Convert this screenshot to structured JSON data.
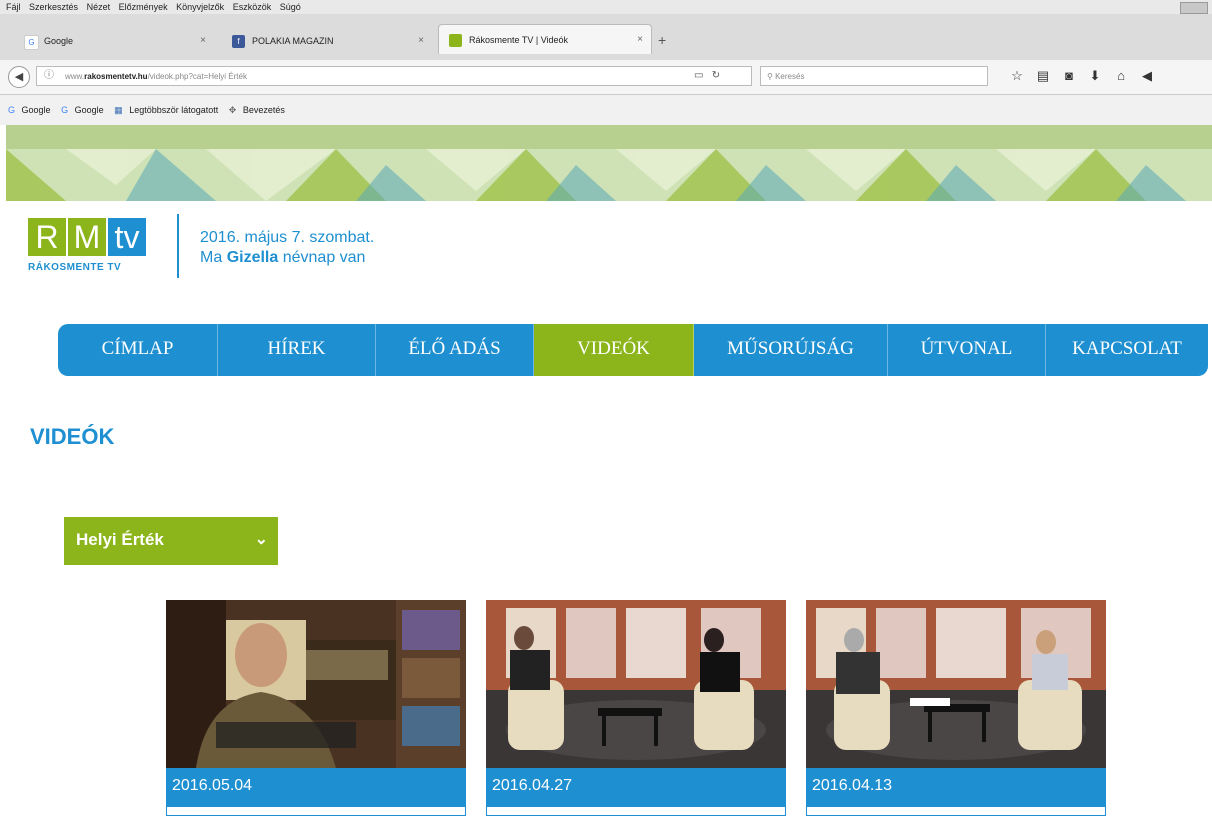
{
  "browser": {
    "menu": [
      "Fájl",
      "Szerkesztés",
      "Nézet",
      "Előzmények",
      "Könyvjelzők",
      "Eszközök",
      "Súgó"
    ],
    "tabs": [
      {
        "title": "Google",
        "icon": "google-icon"
      },
      {
        "title": "POLAKIA MAGAZIN",
        "icon": "facebook-icon"
      },
      {
        "title": "Rákosmente TV | Videók",
        "icon": "rmtv-icon"
      }
    ],
    "url_prefix": "www.",
    "url_domain": "rakosmentetv.hu",
    "url_path": "/videok.php?cat=Helyi Érték",
    "search_placeholder": "Keresés",
    "bookmarks": [
      "Google",
      "Google",
      "Legtöbbször látogatott",
      "Bevezetés"
    ]
  },
  "site": {
    "logo_letters": [
      "R",
      "M",
      "tv"
    ],
    "logo_subtitle": "RÁKOSMENTE TV",
    "date_line": "2016. május 7. szombat.",
    "nameday_prefix": "Ma",
    "nameday_name": "Gizella",
    "nameday_suffix": "névnap van",
    "nav": [
      "CÍMLAP",
      "HÍREK",
      "ÉLŐ ADÁS",
      "VIDEÓK",
      "MŰSORÚJSÁG",
      "ÚTVONAL",
      "KAPCSOLAT"
    ],
    "nav_active": "VIDEÓK",
    "page_title": "VIDEÓK",
    "category_selected": "Helyi Érték",
    "videos": [
      {
        "date": "2016.05.04"
      },
      {
        "date": "2016.04.27"
      },
      {
        "date": "2016.04.13"
      }
    ]
  },
  "colors": {
    "brand_blue": "#1e8fd0",
    "brand_green": "#8bb51a",
    "banner_bg": "#cfe2b5"
  }
}
